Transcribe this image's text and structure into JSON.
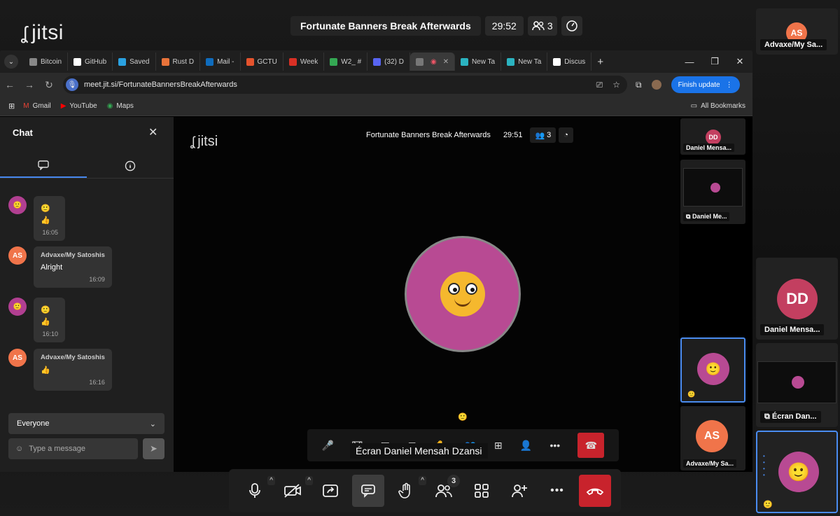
{
  "app": {
    "logo_text": "jitsi",
    "logo_glyph": "ʆ"
  },
  "meeting": {
    "title": "Fortunate Banners Break Afterwards",
    "timer": "29:52",
    "inner_timer": "29:51",
    "participants": "3"
  },
  "browser": {
    "tabs": [
      {
        "label": "Bitcoin",
        "color": "#888888"
      },
      {
        "label": "GitHub",
        "color": "#ffffff"
      },
      {
        "label": "Saved",
        "color": "#2aa1e1"
      },
      {
        "label": "Rust D",
        "color": "#e8733a"
      },
      {
        "label": "Mail -",
        "color": "#0f6cbd"
      },
      {
        "label": "GCTU",
        "color": "#e5532d"
      },
      {
        "label": "Week",
        "color": "#d93025"
      },
      {
        "label": "W2_ #",
        "color": "#34a853"
      },
      {
        "label": "(32) D",
        "color": "#5865f2"
      },
      {
        "label": "",
        "color": "#777777"
      },
      {
        "label": "New Ta",
        "color": "#2bb3c0"
      },
      {
        "label": "New Ta",
        "color": "#2bb3c0"
      },
      {
        "label": "Discus",
        "color": "#ffffff"
      }
    ],
    "url": "meet.jit.si/FortunateBannersBreakAfterwards",
    "finish_update": "Finish update",
    "bookmarks": [
      {
        "label": "Gmail",
        "icon": "M"
      },
      {
        "label": "YouTube",
        "icon": "▶"
      },
      {
        "label": "Maps",
        "icon": "◉"
      }
    ],
    "all_bookmarks": "All Bookmarks"
  },
  "chat": {
    "title": "Chat",
    "messages": [
      {
        "sender": "",
        "lines": [
          "🙂",
          "👍"
        ],
        "time": "16:05",
        "avatar": "🙂"
      },
      {
        "sender": "Advaxe/My Satoshis",
        "lines": [
          "Alright"
        ],
        "time": "16:09",
        "avatar": "AS"
      },
      {
        "sender": "",
        "lines": [
          "🙂",
          "👍"
        ],
        "time": "16:10",
        "avatar": "🙂"
      },
      {
        "sender": "Advaxe/My Satoshis",
        "lines": [
          "👍"
        ],
        "time": "16:16",
        "avatar": "AS"
      }
    ],
    "recipient": "Everyone",
    "placeholder": "Type a message"
  },
  "stage": {
    "caption": "Écran Daniel Mensah Dzansi",
    "small_emoji": "🙂"
  },
  "inner_thumbs": [
    {
      "label": "Daniel Mensa...",
      "initials": "DD"
    },
    {
      "label": "Daniel Me...",
      "initials": ""
    },
    {
      "label": "🙂",
      "initials": ""
    },
    {
      "label": "Advaxe/My Sa...",
      "initials": "AS"
    }
  ],
  "outer_thumbs": [
    {
      "label": "Advaxe/My Sa...",
      "initials": "AS"
    },
    {
      "label": "Daniel Mensa...",
      "initials": "DD"
    },
    {
      "label": "Écran Dan...",
      "initials": ""
    },
    {
      "label": "🙂",
      "initials": ""
    }
  ],
  "colors": {
    "accent": "#4a8cf0",
    "hangup": "#c8232c",
    "avatar_pink": "#b84a93",
    "avatar_orange": "#f0744a"
  }
}
